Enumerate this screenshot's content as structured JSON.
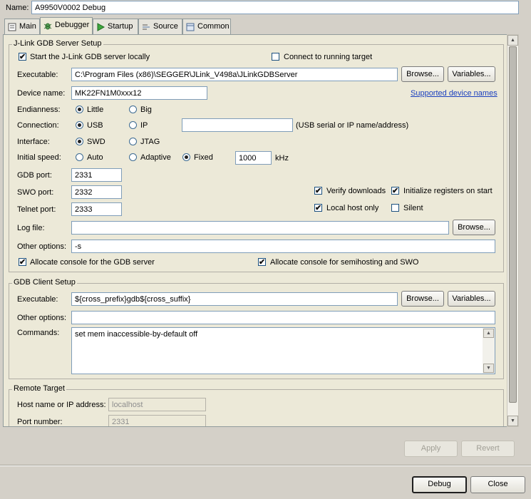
{
  "name_field": {
    "label": "Name:",
    "value": "A9950V0002 Debug"
  },
  "tabs": [
    {
      "label": "Main",
      "icon": "main-tab-icon"
    },
    {
      "label": "Debugger",
      "icon": "debugger-bug-icon"
    },
    {
      "label": "Startup",
      "icon": "startup-play-icon"
    },
    {
      "label": "Source",
      "icon": "source-icon"
    },
    {
      "label": "Common",
      "icon": "common-icon"
    }
  ],
  "server": {
    "group_title": "J-Link GDB Server Setup",
    "start_locally": {
      "label": "Start the J-Link GDB server locally",
      "checked": true
    },
    "connect_running": {
      "label": "Connect to running target",
      "checked": false
    },
    "executable": {
      "label": "Executable:",
      "value": "C:\\Program Files (x86)\\SEGGER\\JLink_V498a\\JLinkGDBServer"
    },
    "browse": "Browse...",
    "variables": "Variables...",
    "device": {
      "label": "Device name:",
      "value": "MK22FN1M0xxx12",
      "link": "Supported device names"
    },
    "endianness": {
      "label": "Endianness:",
      "options": [
        "Little",
        "Big"
      ],
      "selected": "Little"
    },
    "connection": {
      "label": "Connection:",
      "options": [
        "USB",
        "IP"
      ],
      "selected": "USB",
      "value": "",
      "hint": "(USB serial or IP name/address)"
    },
    "interface": {
      "label": "Interface:",
      "options": [
        "SWD",
        "JTAG"
      ],
      "selected": "SWD"
    },
    "speed": {
      "label": "Initial speed:",
      "options": [
        "Auto",
        "Adaptive",
        "Fixed"
      ],
      "selected": "Fixed",
      "value": "1000",
      "unit": "kHz"
    },
    "gdb_port": {
      "label": "GDB port:",
      "value": "2331"
    },
    "swo_port": {
      "label": "SWO port:",
      "value": "2332"
    },
    "telnet_port": {
      "label": "Telnet port:",
      "value": "2333"
    },
    "verify_downloads": {
      "label": "Verify downloads",
      "checked": true
    },
    "init_registers": {
      "label": "Initialize registers on start",
      "checked": true
    },
    "local_host_only": {
      "label": "Local host only",
      "checked": true
    },
    "silent": {
      "label": "Silent",
      "checked": false
    },
    "log_file": {
      "label": "Log file:",
      "value": ""
    },
    "log_browse": "Browse...",
    "other_options": {
      "label": "Other options:",
      "value": "-s"
    },
    "alloc_gdb": {
      "label": "Allocate console for the GDB server",
      "checked": true
    },
    "alloc_semi": {
      "label": "Allocate console for semihosting and SWO",
      "checked": true
    }
  },
  "client": {
    "group_title": "GDB Client Setup",
    "executable": {
      "label": "Executable:",
      "value": "${cross_prefix}gdb${cross_suffix}"
    },
    "browse": "Browse...",
    "variables": "Variables...",
    "other_options": {
      "label": "Other options:",
      "value": ""
    },
    "commands": {
      "label": "Commands:",
      "value": "set mem inaccessible-by-default off"
    }
  },
  "remote": {
    "group_title": "Remote Target",
    "host": {
      "label": "Host name or IP address:",
      "value": "localhost"
    },
    "port": {
      "label": "Port number:",
      "value": "2331"
    }
  },
  "footer": {
    "apply": "Apply",
    "revert": "Revert",
    "debug": "Debug",
    "close": "Close"
  },
  "glyphs": {
    "check": "✔",
    "up": "▲",
    "down": "▼"
  }
}
